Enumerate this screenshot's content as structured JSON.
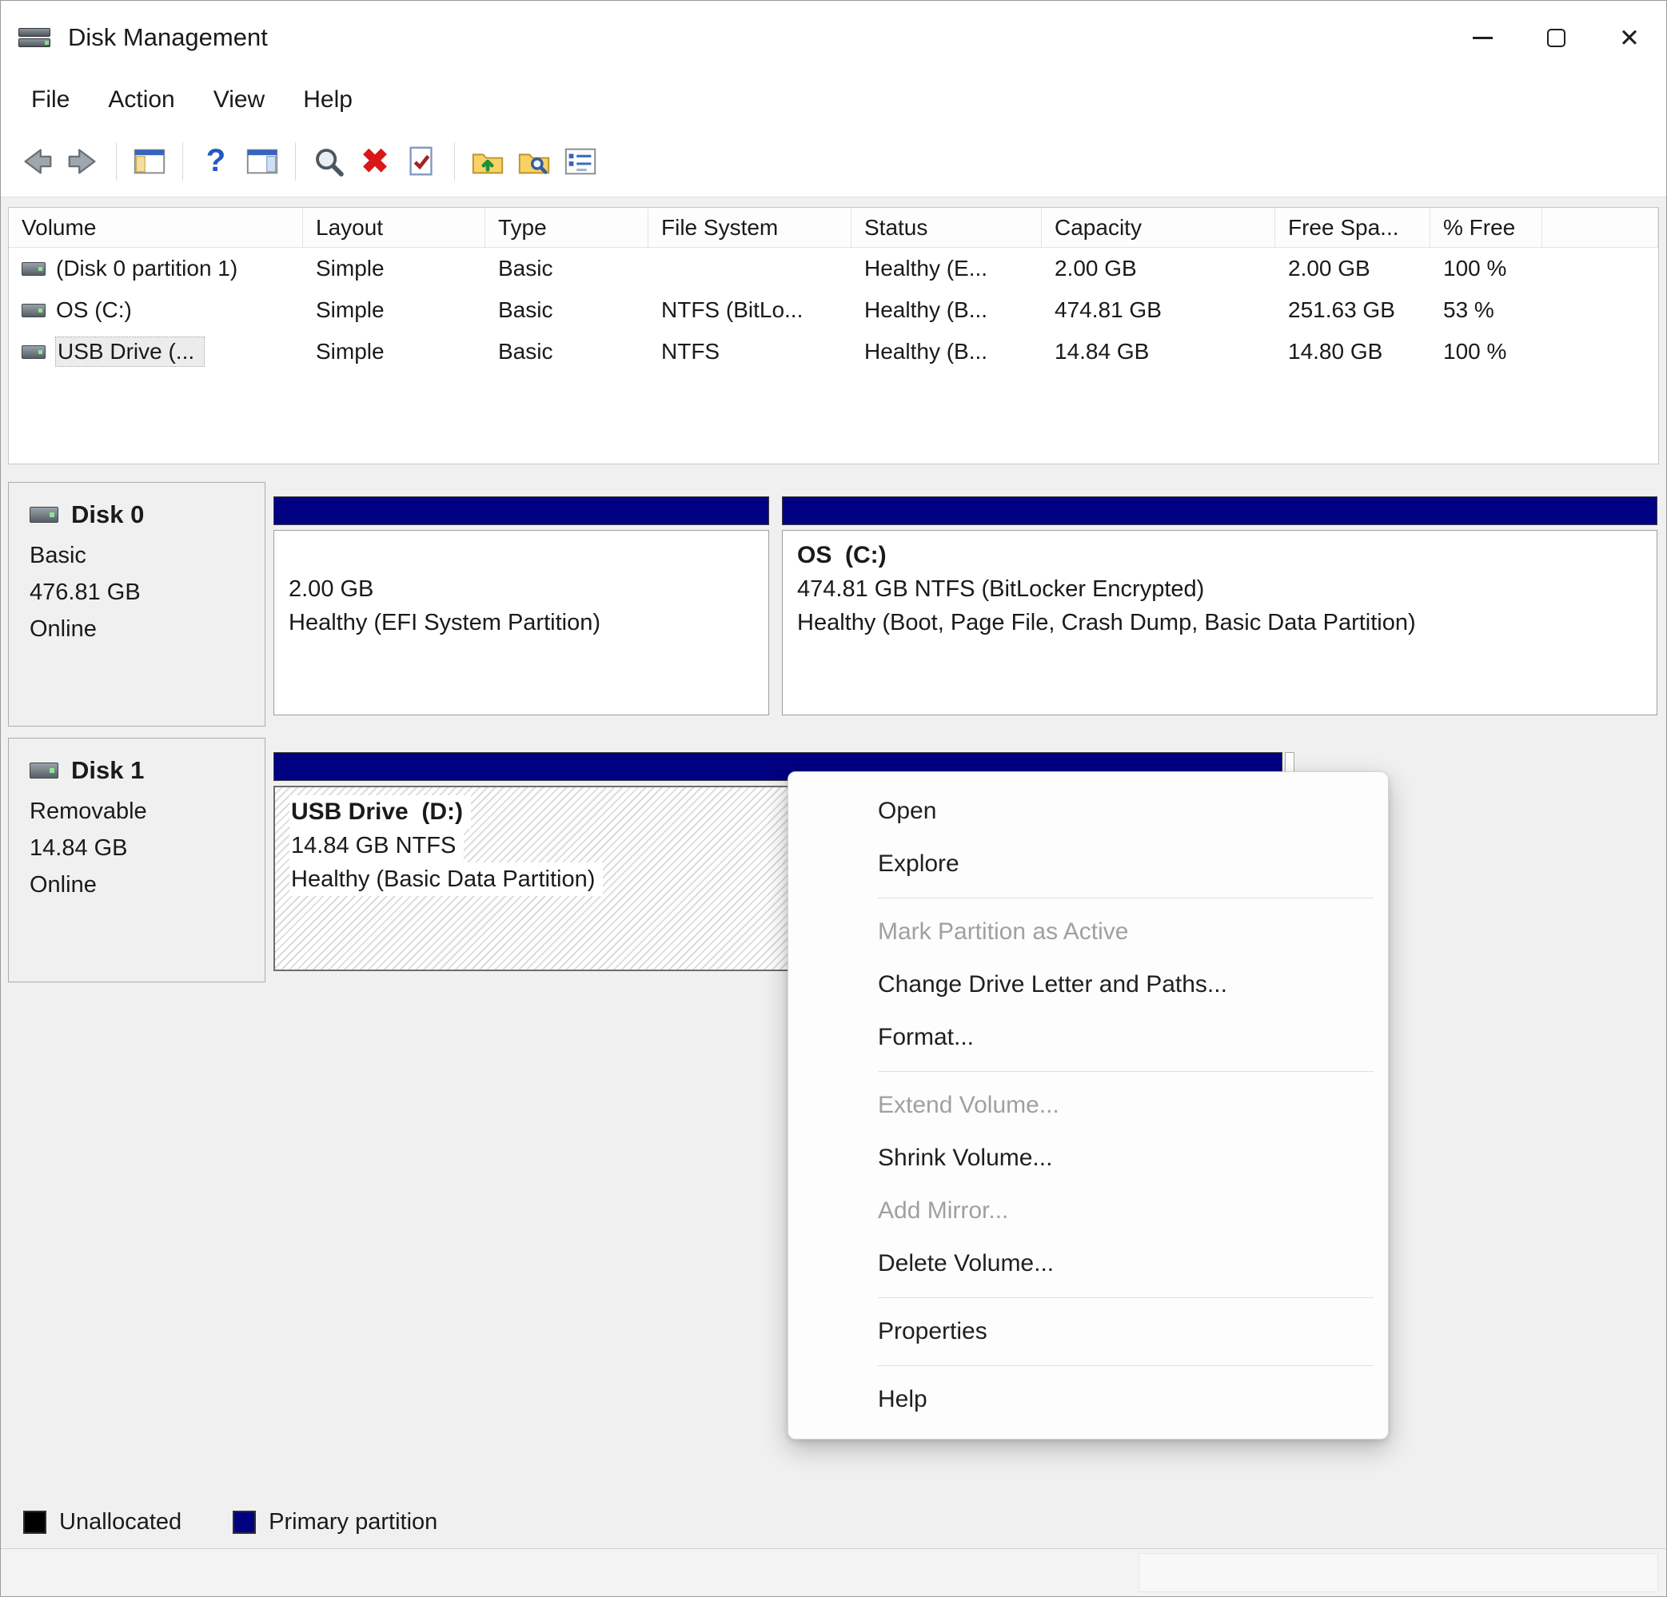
{
  "window": {
    "title": "Disk Management",
    "icon": "disk-drive-icon",
    "controls": [
      "minimize-icon",
      "maximize-icon",
      "close-icon"
    ]
  },
  "menu_bar": {
    "items": [
      {
        "label": "File"
      },
      {
        "label": "Action"
      },
      {
        "label": "View"
      },
      {
        "label": "Help"
      }
    ]
  },
  "toolbar": {
    "icons": [
      "back-arrow-icon",
      "forward-arrow-icon",
      "console-tree-icon",
      "help-icon",
      "action-pane-icon",
      "zoom-icon",
      "delete-volume-icon",
      "check-document-icon",
      "folder-up-icon",
      "folder-search-icon",
      "list-options-icon"
    ]
  },
  "volume_table": {
    "columns": [
      {
        "label": "Volume"
      },
      {
        "label": "Layout"
      },
      {
        "label": "Type"
      },
      {
        "label": "File System"
      },
      {
        "label": "Status"
      },
      {
        "label": "Capacity"
      },
      {
        "label": "Free Spa..."
      },
      {
        "label": "% Free"
      }
    ],
    "rows": [
      {
        "volume": "(Disk 0 partition 1)",
        "layout": "Simple",
        "type": "Basic",
        "file_system": "",
        "status": "Healthy (E...",
        "capacity": "2.00 GB",
        "free_space": "2.00 GB",
        "percent_free": "100 %",
        "selected": false
      },
      {
        "volume": "OS (C:)",
        "layout": "Simple",
        "type": "Basic",
        "file_system": "NTFS (BitLo...",
        "status": "Healthy (B...",
        "capacity": "474.81 GB",
        "free_space": "251.63 GB",
        "percent_free": "53 %",
        "selected": false
      },
      {
        "volume": "USB Drive (...",
        "layout": "Simple",
        "type": "Basic",
        "file_system": "NTFS",
        "status": "Healthy (B...",
        "capacity": "14.84 GB",
        "free_space": "14.80 GB",
        "percent_free": "100 %",
        "selected": true
      }
    ]
  },
  "disks": [
    {
      "name": "Disk 0",
      "kind": "Basic",
      "capacity": "476.81 GB",
      "status": "Online",
      "partitions": [
        {
          "title": "",
          "detail1": "2.00 GB",
          "detail2": "Healthy (EFI System Partition)",
          "selected": false
        },
        {
          "title": "OS  (C:)",
          "detail1": "474.81 GB NTFS (BitLocker Encrypted)",
          "detail2": "Healthy (Boot, Page File, Crash Dump, Basic Data Partition)",
          "selected": false
        }
      ]
    },
    {
      "name": "Disk 1",
      "kind": "Removable",
      "capacity": "14.84 GB",
      "status": "Online",
      "partitions": [
        {
          "title": "USB Drive  (D:)",
          "detail1": "14.84 GB NTFS",
          "detail2": "Healthy (Basic Data Partition)",
          "selected": true
        }
      ]
    }
  ],
  "context_menu": {
    "items": [
      {
        "label": "Open",
        "enabled": true
      },
      {
        "label": "Explore",
        "enabled": true
      },
      {
        "label": "Mark Partition as Active",
        "enabled": false
      },
      {
        "label": "Change Drive Letter and Paths...",
        "enabled": true
      },
      {
        "label": "Format...",
        "enabled": true
      },
      {
        "label": "Extend Volume...",
        "enabled": false
      },
      {
        "label": "Shrink Volume...",
        "enabled": true
      },
      {
        "label": "Add Mirror...",
        "enabled": false
      },
      {
        "label": "Delete Volume...",
        "enabled": true
      },
      {
        "label": "Properties",
        "enabled": true
      },
      {
        "label": "Help",
        "enabled": true
      }
    ]
  },
  "legend": {
    "items": [
      {
        "label": "Unallocated",
        "color": "#000000"
      },
      {
        "label": "Primary partition",
        "color": "#000082"
      }
    ]
  },
  "colors": {
    "partition_bar": "#000082",
    "selection_hatch": "#dcdcdc"
  }
}
